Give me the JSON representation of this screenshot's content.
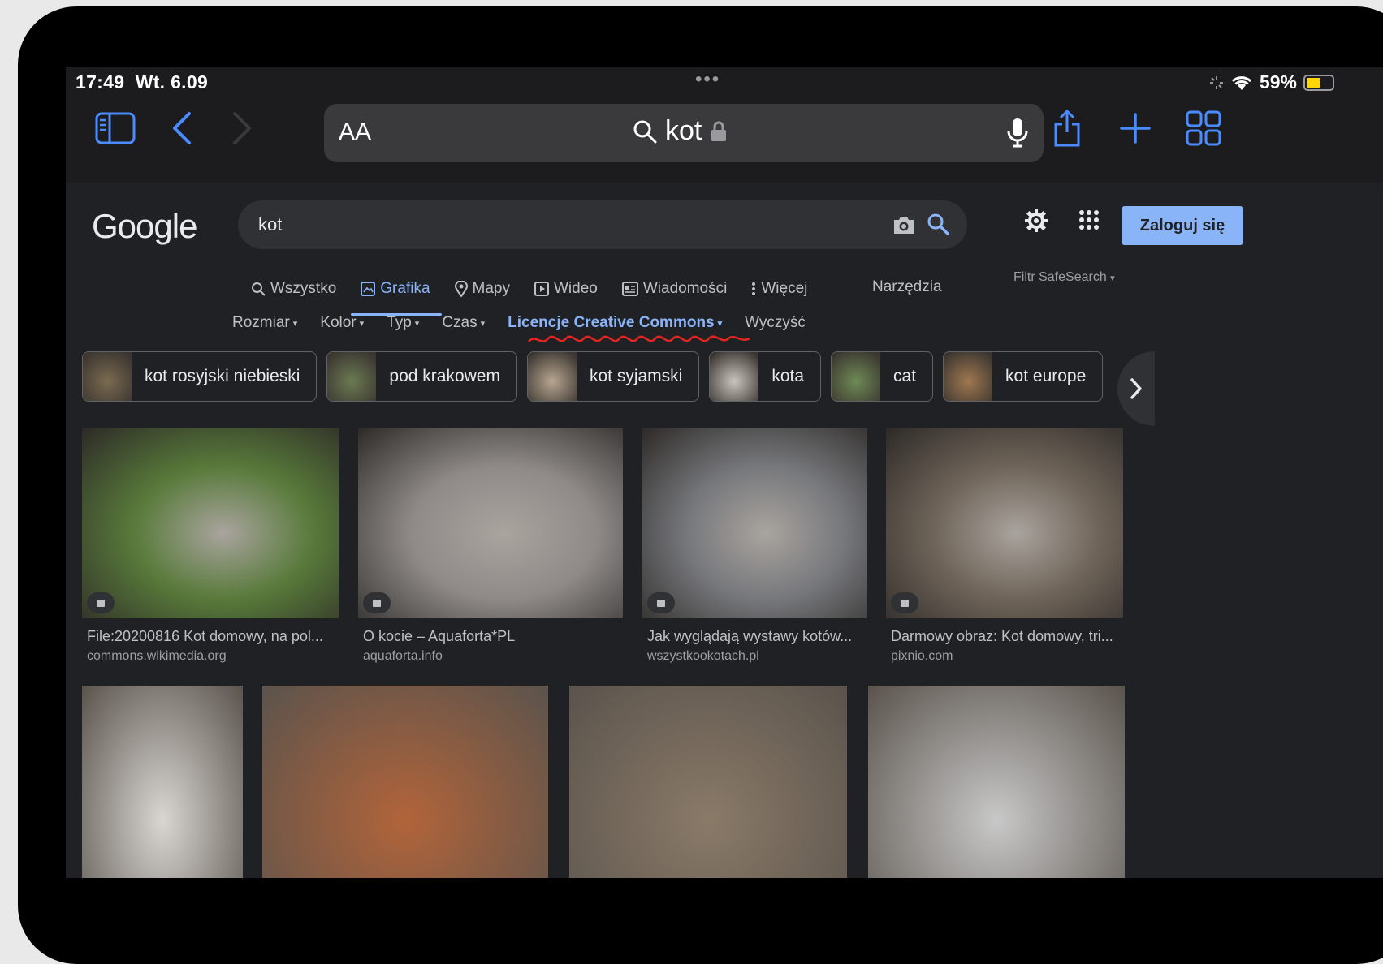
{
  "status": {
    "time": "17:49",
    "date": "Wt. 6.09",
    "battery": "59%",
    "battery_level": 0.59,
    "dots": "•••"
  },
  "safari": {
    "text_size": "AA",
    "url_query": "kot"
  },
  "google": {
    "logo": "Google",
    "query": "kot",
    "login_label": "Zaloguj się",
    "tabs": [
      {
        "label": "Wszystko",
        "icon": "search-icon",
        "active": false
      },
      {
        "label": "Grafika",
        "icon": "image-icon",
        "active": true
      },
      {
        "label": "Mapy",
        "icon": "map-pin-icon",
        "active": false
      },
      {
        "label": "Wideo",
        "icon": "video-icon",
        "active": false
      },
      {
        "label": "Wiadomości",
        "icon": "news-icon",
        "active": false
      },
      {
        "label": "Więcej",
        "icon": "more-vert-icon",
        "active": false
      }
    ],
    "tools_label": "Narzędzia",
    "safesearch_label": "Filtr SafeSearch",
    "filters": [
      {
        "label": "Rozmiar",
        "active": false
      },
      {
        "label": "Kolor",
        "active": false
      },
      {
        "label": "Typ",
        "active": false
      },
      {
        "label": "Czas",
        "active": false
      },
      {
        "label": "Licencje Creative Commons",
        "active": true
      }
    ],
    "clear_label": "Wyczyść",
    "chips": [
      {
        "label": "kot rosyjski niebieski",
        "color": "#7a6a50"
      },
      {
        "label": "pod krakowem",
        "color": "#6b7a52"
      },
      {
        "label": "kot syjamski",
        "color": "#b8a690"
      },
      {
        "label": "kota",
        "color": "#c9c4bd"
      },
      {
        "label": "cat",
        "color": "#6f8a55"
      },
      {
        "label": "kot europe",
        "color": "#a07850"
      }
    ],
    "results": [
      {
        "title": "File:20200816 Kot domowy, na pol...",
        "source": "commons.wikimedia.org",
        "color": "#587a3a"
      },
      {
        "title": "O kocie – Aquaforta*PL",
        "source": "aquaforta.info",
        "color": "#8f8a88"
      },
      {
        "title": "Jak wyglądają wystawy kotów...",
        "source": "wszystkookotach.pl",
        "color": "#77787c"
      },
      {
        "title": "Darmowy obraz: Kot domowy, tri...",
        "source": "pixnio.com",
        "color": "#6f6459"
      }
    ],
    "row2_colors": [
      "#d9d6d2",
      "#b2643a",
      "#8a7a68",
      "#c8c8c8"
    ]
  }
}
